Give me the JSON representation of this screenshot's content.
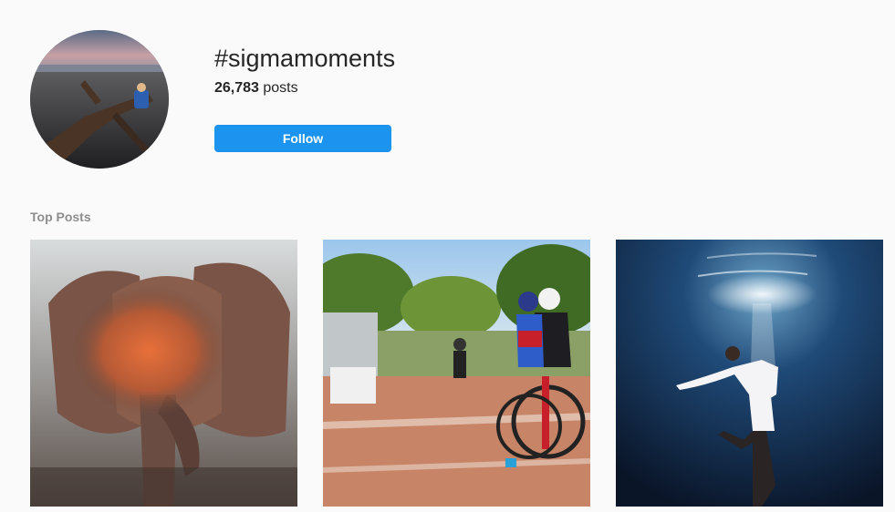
{
  "hashtag": {
    "title": "#sigmamoments",
    "post_count": "26,783",
    "post_count_suffix": " posts",
    "follow_label": "Follow"
  },
  "top_posts": {
    "heading": "Top Posts",
    "items": [
      {
        "subject": "elephant-dust-photo"
      },
      {
        "subject": "cycling-race-photo"
      },
      {
        "subject": "underwater-dancer-photo"
      }
    ]
  },
  "colors": {
    "background": "#fafafa",
    "follow_button": "#1c93ee",
    "muted_text": "#8e8e8e"
  }
}
